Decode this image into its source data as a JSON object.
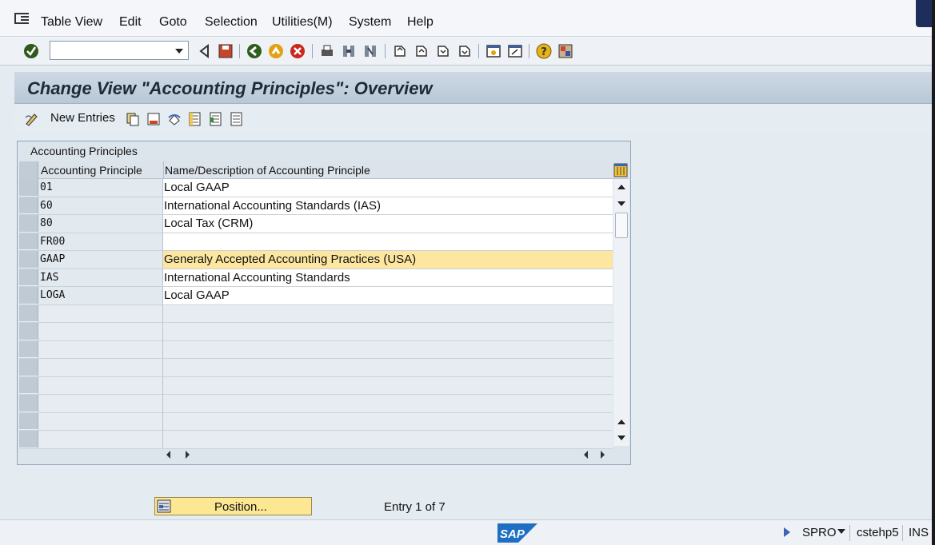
{
  "menu": [
    "Table View",
    "Edit",
    "Goto",
    "Selection",
    "Utilities(M)",
    "System",
    "Help"
  ],
  "command_field": "",
  "title": "Change View \"Accounting Principles\": Overview",
  "app_toolbar": {
    "new_entries": "New Entries"
  },
  "table": {
    "title": "Accounting Principles",
    "columns": [
      "Accounting Principle",
      "Name/Description of Accounting Principle"
    ],
    "rows": [
      {
        "code": "01",
        "desc": "Local GAAP"
      },
      {
        "code": "60",
        "desc": "International Accounting Standards (IAS)"
      },
      {
        "code": "80",
        "desc": "Local Tax (CRM)"
      },
      {
        "code": "FR00",
        "desc": ""
      },
      {
        "code": "GAAP",
        "desc": "Generaly Accepted Accounting Practices (USA)"
      },
      {
        "code": "IAS",
        "desc": "International Accounting Standards"
      },
      {
        "code": "LOGA",
        "desc": "Local GAAP"
      }
    ],
    "empty_rows": 8
  },
  "position_button": "Position...",
  "entry_info": "Entry 1 of 7",
  "status": {
    "transaction": "SPRO",
    "system": "cstehp5",
    "mode": "INS"
  },
  "colors": {
    "highlight": "#fde7a0",
    "title_bg": "#c3d0dd"
  }
}
